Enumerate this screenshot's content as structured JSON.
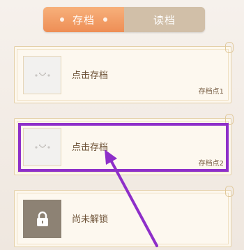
{
  "tabs": {
    "save_label": "存档",
    "load_label": "读档"
  },
  "slots": [
    {
      "label": "点击存档",
      "sub": "存档点1",
      "state": "empty"
    },
    {
      "label": "点击存档",
      "sub": "存档点2",
      "state": "empty"
    },
    {
      "label": "尚未解锁",
      "sub": "",
      "state": "locked"
    }
  ],
  "colors": {
    "active_tab": "#ee8e55",
    "inactive_tab": "#d1bfa8",
    "card_border": "#e3cfa6",
    "highlight": "#8e2fc9",
    "arrow": "#8e2fc9"
  },
  "icons": {
    "empty_slot": "cat-face-icon",
    "locked_slot": "lock-icon"
  }
}
